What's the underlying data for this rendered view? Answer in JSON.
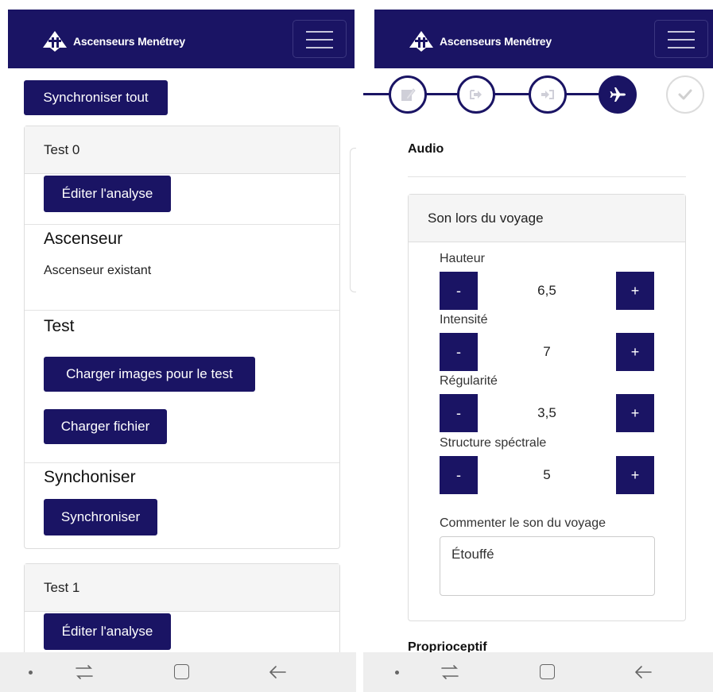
{
  "brand": {
    "name": "Ascenseurs Menétrey"
  },
  "colors": {
    "primary": "#1a1464",
    "card_header": "#f5f5f5",
    "sysnav": "#eeeeee"
  },
  "left": {
    "sync_all_label": "Synchroniser tout",
    "cards": [
      {
        "title": "Test 0",
        "edit_label": "Éditer l'analyse",
        "elevator_heading": "Ascenseur",
        "elevator_value": "Ascenseur existant",
        "test_heading": "Test",
        "load_images_label": "Charger images pour le test",
        "load_file_label": "Charger fichier",
        "sync_heading": "Synchoniser",
        "sync_label": "Synchroniser"
      },
      {
        "title": "Test 1",
        "edit_label": "Éditer l'analyse"
      }
    ]
  },
  "right": {
    "steps": [
      {
        "icon": "edit-icon",
        "state": "done"
      },
      {
        "icon": "sign-out-icon",
        "state": "done"
      },
      {
        "icon": "sign-in-icon",
        "state": "done"
      },
      {
        "icon": "plane-icon",
        "state": "active"
      },
      {
        "icon": "check-icon",
        "state": "future"
      }
    ],
    "section_title": "Audio",
    "panel_title": "Son lors du voyage",
    "fields": [
      {
        "label": "Hauteur",
        "value": "6,5"
      },
      {
        "label": "Intensité",
        "value": "7"
      },
      {
        "label": "Régularité",
        "value": "3,5"
      },
      {
        "label": "Structure spéctrale",
        "value": "5"
      }
    ],
    "minus_label": "-",
    "plus_label": "+",
    "comment_label": "Commenter le son du voyage",
    "comment_value": "Étouffé",
    "next_section_title": "Proprioceptif"
  }
}
